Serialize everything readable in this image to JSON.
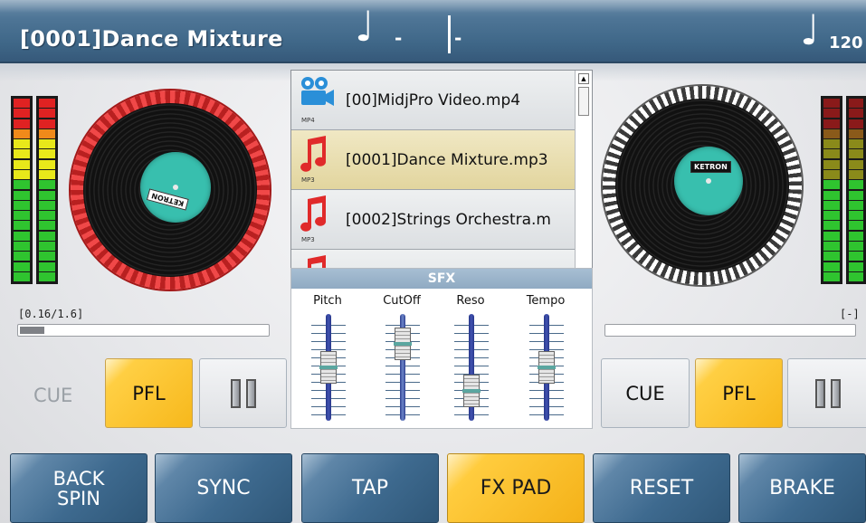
{
  "titlebar": {
    "song_title": "[0001]Dance Mixture",
    "beat_icon": "quarter-note-icon",
    "beat_value": "-",
    "division_value": "-",
    "tempo_icon": "quarter-note-icon",
    "tempo_value": "120"
  },
  "deck_left": {
    "position_text": "[0.16/1.6]",
    "progress": 0.1,
    "platter_color": "#e23a3a",
    "label_color": "#38bfae",
    "label_text": "KETRON",
    "cue_label": "CUE",
    "pfl_label": "PFL",
    "pause_icon": "pause-icon"
  },
  "deck_right": {
    "position_text": "[-]",
    "progress": 0,
    "label_color": "#38bfae",
    "label_text": "KETRON",
    "cue_label": "CUE",
    "pfl_label": "PFL",
    "pause_icon": "pause-icon"
  },
  "file_list": [
    {
      "name": "[00]MidjPro Video.mp4",
      "type": "MP4",
      "icon": "video-camera-icon",
      "selected": false
    },
    {
      "name": "[0001]Dance Mixture.mp3",
      "type": "MP3",
      "icon": "music-note-icon",
      "selected": true
    },
    {
      "name": "[0002]Strings Orchestra.m",
      "type": "MP3",
      "icon": "music-note-icon",
      "selected": false
    }
  ],
  "sfx": {
    "title": "SFX",
    "sliders": [
      {
        "label": "Pitch",
        "level": 0.5
      },
      {
        "label": "CutOff",
        "level": 0.82
      },
      {
        "label": "Reso",
        "level": 0.18
      },
      {
        "label": "Tempo",
        "level": 0.5
      }
    ]
  },
  "bottom_bar": [
    {
      "label": "BACK SPIN",
      "active": false
    },
    {
      "label": "SYNC",
      "active": false
    },
    {
      "label": "TAP",
      "active": false
    },
    {
      "label": "FX PAD",
      "active": true
    },
    {
      "label": "RESET",
      "active": false
    },
    {
      "label": "BRAKE",
      "active": false
    }
  ],
  "colors": {
    "accent_blue": "#3f6788",
    "accent_orange": "#f7b81c",
    "selected_row": "#e2d59e",
    "record_label": "#38bfae"
  }
}
